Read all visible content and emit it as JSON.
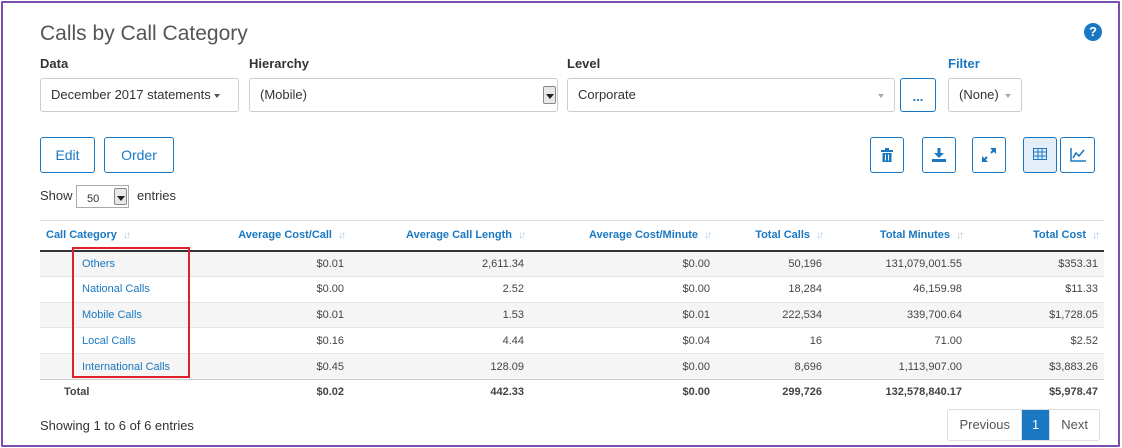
{
  "header": {
    "title": "Calls by Call Category",
    "help_icon": "question-circle-icon"
  },
  "filters": {
    "data_label": "Data",
    "data_value": "December 2017 statements",
    "hierarchy_label": "Hierarchy",
    "hierarchy_value": "(Mobile)",
    "level_label": "Level",
    "level_value": "Corporate",
    "level_browse": "...",
    "filter_label": "Filter",
    "filter_value": "(None)"
  },
  "toolbar": {
    "edit_label": "Edit",
    "order_label": "Order",
    "icons": [
      "trash-icon",
      "download-icon",
      "expand-icon",
      "table-view-icon",
      "chart-view-icon"
    ]
  },
  "length": {
    "show": "Show",
    "value": "50",
    "entries": "entries"
  },
  "table": {
    "columns": [
      "Call Category",
      "Average Cost/Call",
      "Average Call Length",
      "Average Cost/Minute",
      "Total Calls",
      "Total Minutes",
      "Total Cost"
    ],
    "rows": [
      [
        "Others",
        "$0.01",
        "2,611.34",
        "$0.00",
        "50,196",
        "131,079,001.55",
        "$353.31"
      ],
      [
        "National Calls",
        "$0.00",
        "2.52",
        "$0.00",
        "18,284",
        "46,159.98",
        "$11.33"
      ],
      [
        "Mobile Calls",
        "$0.01",
        "1.53",
        "$0.01",
        "222,534",
        "339,700.64",
        "$1,728.05"
      ],
      [
        "Local Calls",
        "$0.16",
        "4.44",
        "$0.04",
        "16",
        "71.00",
        "$2.52"
      ],
      [
        "International Calls",
        "$0.45",
        "128.09",
        "$0.00",
        "8,696",
        "1,113,907.00",
        "$3,883.26"
      ]
    ],
    "total": [
      "Total",
      "$0.02",
      "442.33",
      "$0.00",
      "299,726",
      "132,578,840.17",
      "$5,978.47"
    ]
  },
  "footer": {
    "info": "Showing 1 to 6 of 6 entries",
    "previous": "Previous",
    "page": "1",
    "next": "Next"
  },
  "colors": {
    "accent": "#1a78c2",
    "panel_border": "#7a4fb0",
    "highlight": "#e0202a"
  }
}
